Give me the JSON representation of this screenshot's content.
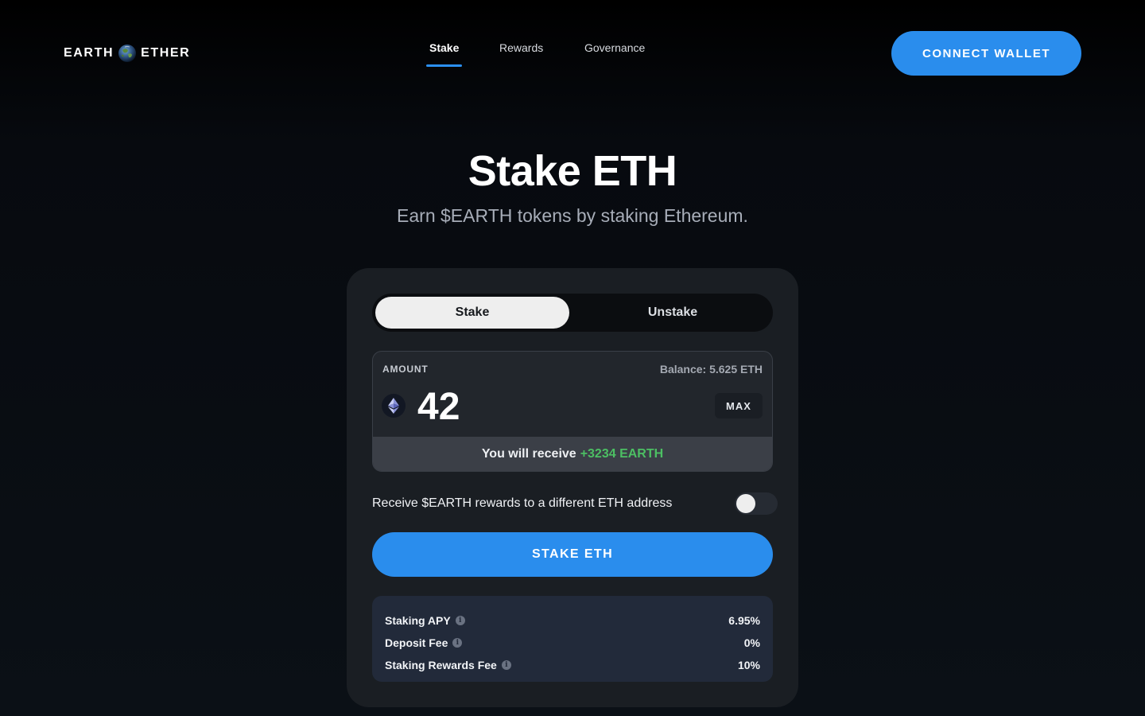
{
  "header": {
    "logo_left": "EARTH",
    "logo_right": "ETHER",
    "nav": [
      {
        "label": "Stake",
        "active": true
      },
      {
        "label": "Rewards",
        "active": false
      },
      {
        "label": "Governance",
        "active": false
      }
    ],
    "connect_label": "CONNECT WALLET"
  },
  "hero": {
    "title": "Stake ETH",
    "subtitle": "Earn $EARTH tokens by staking Ethereum."
  },
  "card": {
    "tabs": [
      {
        "label": "Stake",
        "active": true
      },
      {
        "label": "Unstake",
        "active": false
      }
    ],
    "amount": {
      "label": "AMOUNT",
      "balance": "Balance: 5.625 ETH",
      "value": "42",
      "token_icon": "ethereum-icon",
      "max_label": "MAX",
      "receive_prefix": "You will receive",
      "receive_amount": "+3234 EARTH"
    },
    "different_address": {
      "label": "Receive $EARTH rewards to a different ETH address",
      "enabled": false
    },
    "stake_button": "STAKE ETH",
    "stats": [
      {
        "name": "Staking APY",
        "value": "6.95%"
      },
      {
        "name": "Deposit Fee",
        "value": "0%"
      },
      {
        "name": "Staking Rewards Fee",
        "value": "10%"
      }
    ]
  },
  "colors": {
    "accent": "#2a8ded",
    "positive": "#4cbf63",
    "card_bg": "#1a1e23",
    "stats_bg": "#222a3a"
  }
}
